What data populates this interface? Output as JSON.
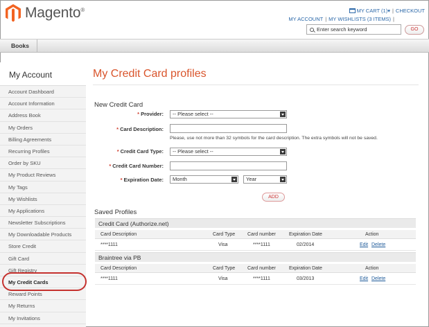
{
  "header": {
    "logo_text": "Magento",
    "logo_mark": "®",
    "cart": "MY CART (1)",
    "cart_caret": "▾",
    "checkout": "CHECKOUT",
    "my_account": "MY ACCOUNT",
    "my_wishlists": "MY WISHLISTS (3 ITEMS)",
    "search_placeholder": "Enter search keyword",
    "go_label": "GO"
  },
  "nav": {
    "items": [
      "Books"
    ]
  },
  "sidebar": {
    "title": "My Account",
    "items": [
      "Account Dashboard",
      "Account Information",
      "Address Book",
      "My Orders",
      "Billing Agreements",
      "Recurring Profiles",
      "Order by SKU",
      "My Product Reviews",
      "My Tags",
      "My Wishlists",
      "My Applications",
      "Newsletter Subscriptions",
      "My Downloadable Products",
      "Store Credit",
      "Gift Card",
      "Gift Registry",
      "My Credit Cards",
      "Reward Points",
      "My Returns",
      "My Invitations"
    ],
    "active": "My Credit Cards"
  },
  "main": {
    "title": "My Credit Card profiles",
    "new_card": {
      "heading": "New Credit Card",
      "provider_label": "Provider:",
      "provider_value": "-- Please select --",
      "description_label": "Card Description:",
      "description_hint": "Please, use not more than 32 symbols for the card description. The extra symbols will not be saved.",
      "type_label": "Credit Card Type:",
      "type_value": "-- Please select --",
      "number_label": "Credit Card Number:",
      "expiration_label": "Expiration Date:",
      "month_value": "Month",
      "year_value": "Year",
      "add_label": "ADD"
    },
    "saved": {
      "heading": "Saved Profiles",
      "columns": [
        "Card Description",
        "Card Type",
        "Card number",
        "Expiration Date",
        "Action"
      ],
      "groups": [
        {
          "name": "Credit Card (Authorize.net)",
          "rows": [
            {
              "description": "****1111",
              "type": "Visa",
              "number": "****1111",
              "expiration": "02/2014",
              "edit": "Edit",
              "delete": "Delete"
            }
          ]
        },
        {
          "name": "Braintree via PB",
          "rows": [
            {
              "description": "****1111",
              "type": "Visa",
              "number": "****1111",
              "expiration": "03/2013",
              "edit": "Edit",
              "delete": "Delete"
            }
          ]
        }
      ]
    }
  },
  "colors": {
    "accent": "#d9542b",
    "link": "#2a67a8",
    "highlight": "#c5302d"
  }
}
